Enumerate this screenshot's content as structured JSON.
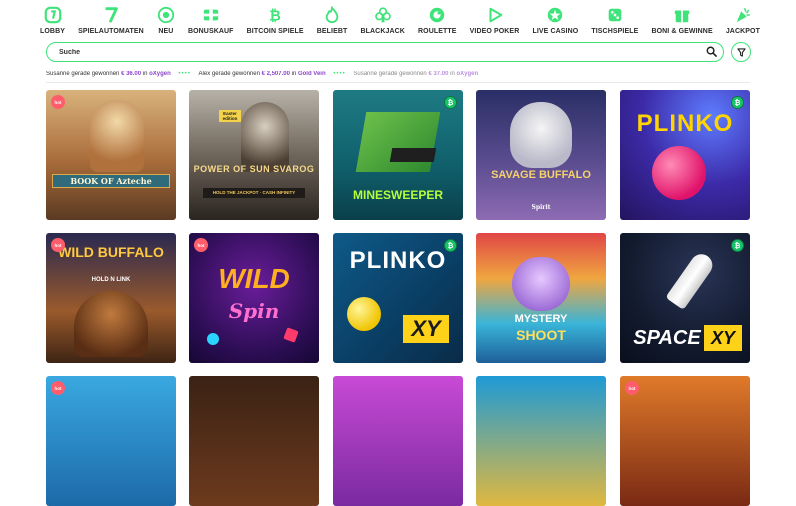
{
  "nav": [
    {
      "label": "LOBBY",
      "icon": "lobby-icon"
    },
    {
      "label": "SPIELAUTOMATEN",
      "icon": "seven-icon"
    },
    {
      "label": "NEU",
      "icon": "new-icon"
    },
    {
      "label": "BONUSKAUF",
      "icon": "bonus-buy-icon"
    },
    {
      "label": "BITCOIN SPIELE",
      "icon": "bitcoin-icon"
    },
    {
      "label": "BELIEBT",
      "icon": "flame-icon"
    },
    {
      "label": "BLACKJACK",
      "icon": "club-icon"
    },
    {
      "label": "ROULETTE",
      "icon": "roulette-icon"
    },
    {
      "label": "VIDEO POKER",
      "icon": "play-icon"
    },
    {
      "label": "LIVE CASINO",
      "icon": "live-casino-icon"
    },
    {
      "label": "TISCHSPIELE",
      "icon": "dice-icon"
    },
    {
      "label": "BONI & GEWINNE",
      "icon": "gift-icon"
    },
    {
      "label": "JACKPOT",
      "icon": "party-popper-icon"
    }
  ],
  "search": {
    "placeholder": "Suche"
  },
  "ticker": [
    {
      "text": "Susanne gerade gewonnen ",
      "amount": "€ 36.00",
      "mid": " in ",
      "game": "oXygen"
    },
    {
      "text": "Alex gerade gewonnen ",
      "amount": "€ 2,507.00",
      "mid": " in ",
      "game": "Gold Vein"
    },
    {
      "text": "Susanne gerade gewonnen ",
      "amount": "€ 37.00",
      "mid": " in ",
      "game": "oXygen"
    }
  ],
  "badges": {
    "hot": "hot",
    "btc": "₿"
  },
  "games": [
    {
      "name": "Book of Aztec",
      "title_text": "BOOK OF Azteche",
      "badge": "hot"
    },
    {
      "name": "Power of Sun Svarog",
      "title_text": "POWER OF SUN SVAROG",
      "sub": "HOLD THE JACKPOT · CASH INFINITY",
      "tag": "Easter edition",
      "badge": ""
    },
    {
      "name": "Minesweeper",
      "title_text": "MINESWEEPER",
      "badge": "btc"
    },
    {
      "name": "Savage Buffalo Spirit",
      "title_text": "SAVAGE BUFFALO",
      "sub": "Spirit",
      "badge": ""
    },
    {
      "name": "Plinko",
      "title_text": "PLINKO",
      "badge": "btc"
    },
    {
      "name": "Wild Buffalo Hold n Link",
      "title_text": "WILD BUFFALO",
      "sub": "HOLD N LINK",
      "badge": "hot"
    },
    {
      "name": "Wild Spin",
      "title_text": "WILD",
      "sub": "Spin",
      "badge": "hot"
    },
    {
      "name": "Plinko XY",
      "title_text": "PLINKO",
      "sub": "XY",
      "badge": "btc"
    },
    {
      "name": "Mystery Shoot",
      "title_text": "MYSTERY",
      "sub": "SHOOT",
      "badge": ""
    },
    {
      "name": "Space XY",
      "title_text": "SPACE",
      "sub": "XY",
      "badge": "btc"
    }
  ]
}
